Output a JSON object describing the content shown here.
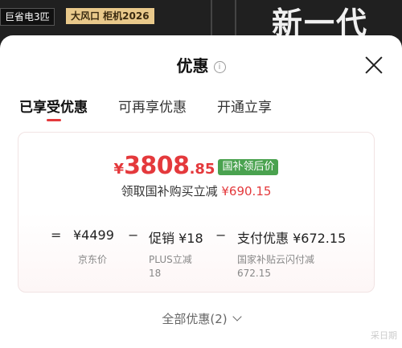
{
  "banner": {
    "tag_left": "巨省电3匹",
    "tag_right": "大风口 柜机2026",
    "headline": "新一代"
  },
  "sheet": {
    "title": "优惠",
    "info_icon": "i",
    "tabs": [
      {
        "label": "已享受优惠",
        "active": true
      },
      {
        "label": "可再享优惠",
        "active": false
      },
      {
        "label": "开通立享",
        "active": false
      }
    ]
  },
  "price": {
    "currency": "¥",
    "integer": "3808",
    "decimal": ".85",
    "badge": "国补领后价",
    "sub_label": "领取国补购买立减",
    "sub_amount": "¥690.15"
  },
  "calc": {
    "op_eq": "=",
    "base_amount": "¥4499",
    "base_desc": "京东价",
    "op_minus1": "−",
    "promo_amount": "促销 ¥18",
    "promo_desc_line1": "PLUS立减",
    "promo_desc_line2": "18",
    "op_minus2": "−",
    "pay_amount": "支付优惠 ¥672.15",
    "pay_desc_line1": "国家补贴云闪付减",
    "pay_desc_line2": "672.15"
  },
  "footer": {
    "all_deals": "全部优惠(2)",
    "watermark": "采日期"
  }
}
